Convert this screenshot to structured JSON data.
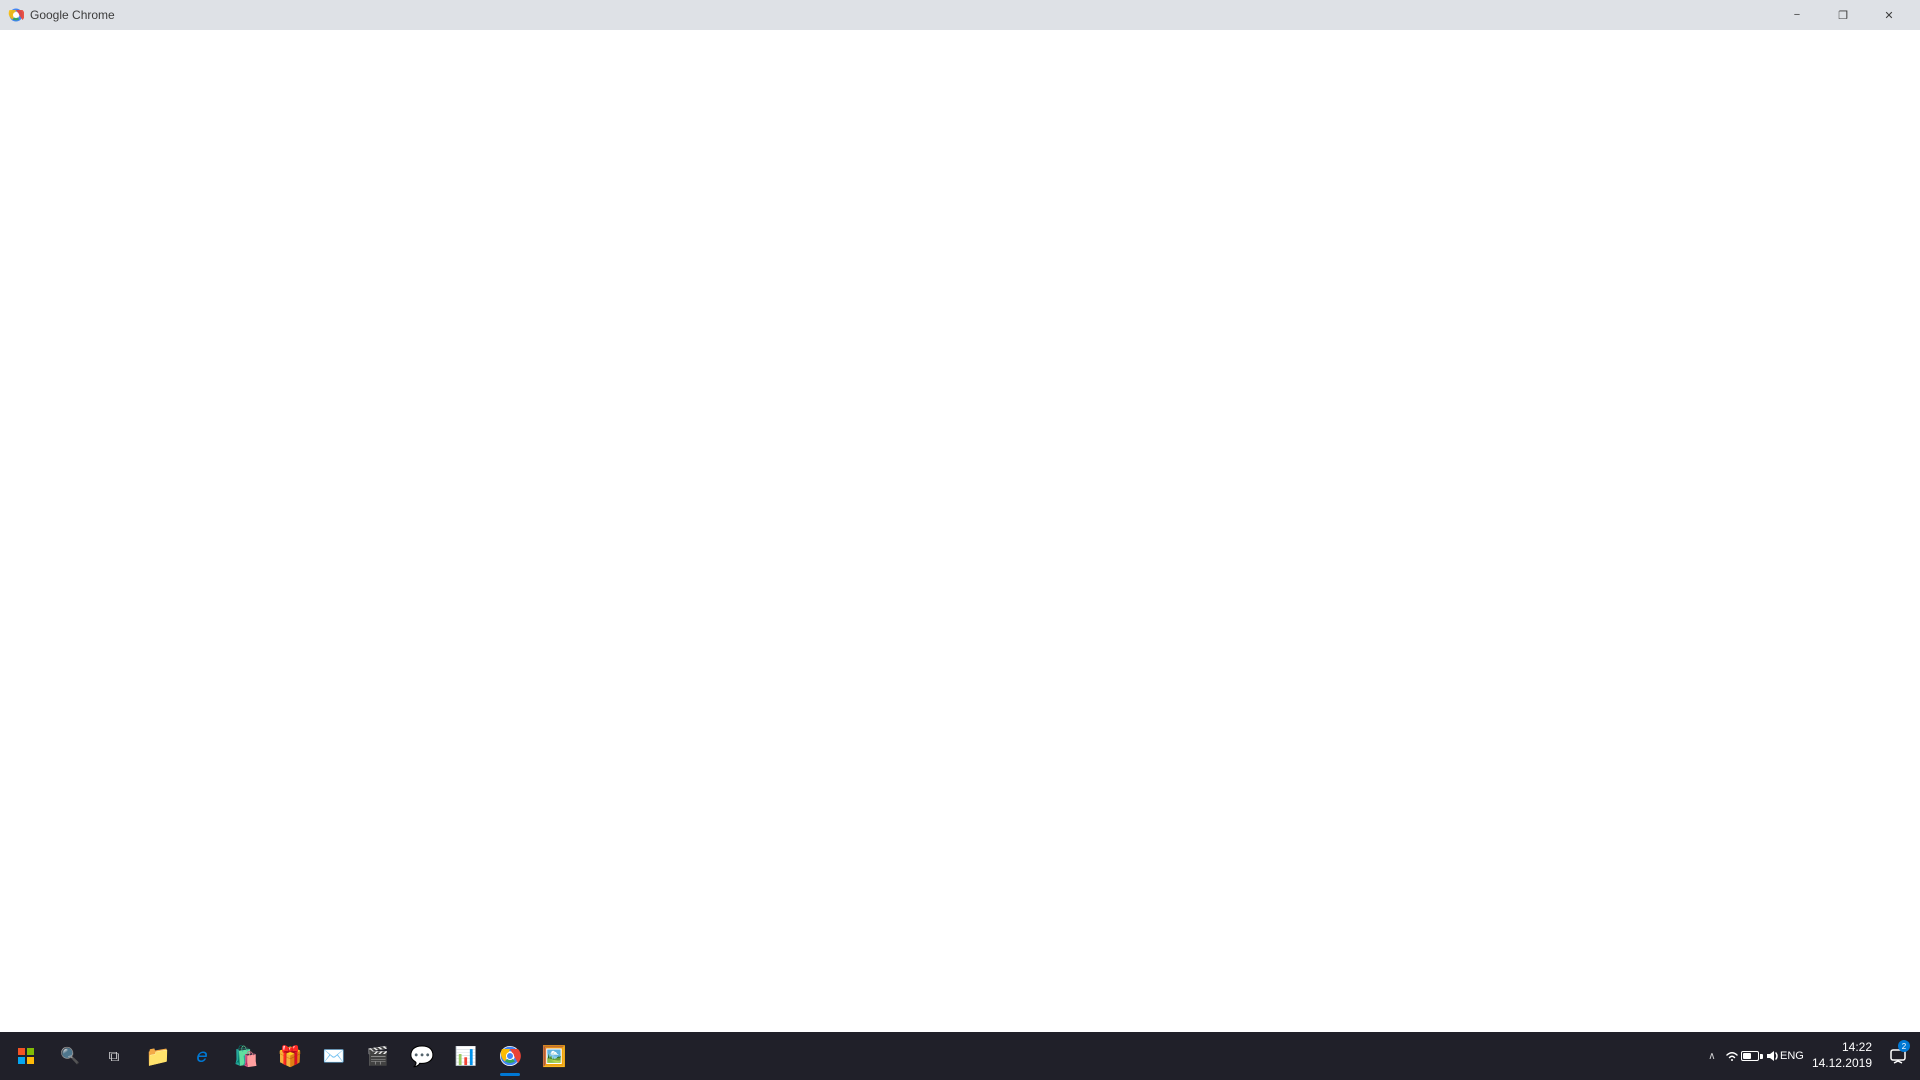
{
  "titlebar": {
    "app_name": "Google Chrome",
    "minimize_label": "−",
    "restore_label": "❐",
    "close_label": "✕"
  },
  "content": {
    "background": "#ffffff"
  },
  "taskbar": {
    "search_placeholder": "Search",
    "clock": {
      "time": "14:22",
      "date": "14.12.2019"
    },
    "language": "ENG",
    "notification_count": "2",
    "apps": [
      {
        "name": "start",
        "label": "Start"
      },
      {
        "name": "search",
        "label": "Search"
      },
      {
        "name": "task-view",
        "label": "Task View"
      },
      {
        "name": "file-explorer",
        "label": "File Explorer"
      },
      {
        "name": "edge",
        "label": "Microsoft Edge"
      },
      {
        "name": "store",
        "label": "Microsoft Store"
      },
      {
        "name": "gift",
        "label": "Get Gifts"
      },
      {
        "name": "mail",
        "label": "Mail"
      },
      {
        "name": "media-player",
        "label": "Media Player"
      },
      {
        "name": "whatsapp",
        "label": "WhatsApp"
      },
      {
        "name": "powerpoint",
        "label": "PowerPoint"
      },
      {
        "name": "chrome",
        "label": "Google Chrome"
      },
      {
        "name": "files",
        "label": "Files"
      }
    ]
  }
}
